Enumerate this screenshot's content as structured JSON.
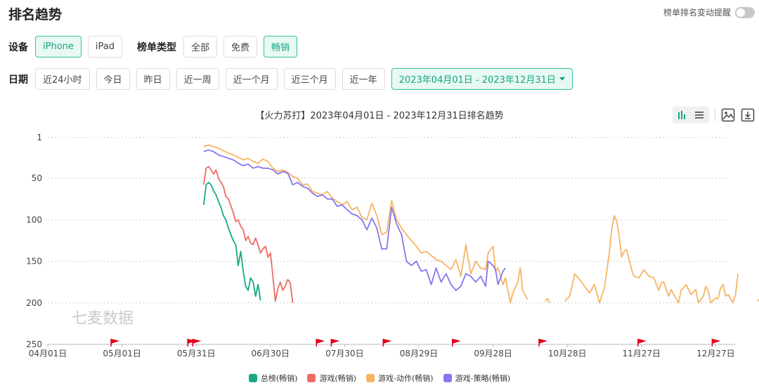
{
  "header": {
    "title": "排名趋势",
    "alert_toggle_label": "榜单排名变动提醒"
  },
  "filters": {
    "device_label": "设备",
    "devices": [
      "iPhone",
      "iPad"
    ],
    "chart_type_label": "榜单类型",
    "chart_types": [
      "全部",
      "免费",
      "畅销"
    ],
    "date_label": "日期",
    "dates": [
      "近24小时",
      "今日",
      "昨日",
      "近一周",
      "近一个月",
      "近三个月",
      "近一年"
    ],
    "date_range": "2023年04月01日 - 2023年12月31日"
  },
  "colors": {
    "accent": "#14a583",
    "total": "#16a984",
    "game": "#ee6b62",
    "action": "#f7b462",
    "strategy": "#8776ee",
    "flag": "#e0001b"
  },
  "watermark": "七麦数据",
  "icons": [
    "bar-chart-icon",
    "list-icon",
    "image-icon",
    "download-icon"
  ],
  "chart_data": {
    "type": "line",
    "title": "【火力苏打】2023年04月01日 - 2023年12月31日排名趋势",
    "y_reversed": true,
    "ylim": [
      1,
      250
    ],
    "yticks": [
      1,
      50,
      100,
      150,
      200,
      250
    ],
    "xlim": [
      "04月01日",
      "12月31日"
    ],
    "xticks": [
      "04月01日",
      "05月01日",
      "05月31日",
      "06月30日",
      "07月30日",
      "08月29日",
      "09月28日",
      "10月28日",
      "11月27日",
      "12月27日"
    ],
    "grid": true,
    "legend_position": "bottom",
    "flags_days": [
      27,
      58,
      60,
      110,
      116,
      137,
      165,
      200,
      240,
      270
    ],
    "series": [
      {
        "name": "总榜(畅销)",
        "color_key": "total",
        "points": [
          [
            63,
            82
          ],
          [
            64,
            58
          ],
          [
            65,
            55
          ],
          [
            66,
            58
          ],
          [
            67,
            65
          ],
          [
            68,
            70
          ],
          [
            69,
            78
          ],
          [
            70,
            85
          ],
          [
            71,
            95
          ],
          [
            72,
            100
          ],
          [
            73,
            110
          ],
          [
            74,
            118
          ],
          [
            75,
            125
          ],
          [
            76,
            130
          ],
          [
            77,
            155
          ],
          [
            78,
            138
          ],
          [
            79,
            162
          ],
          [
            80,
            180
          ],
          [
            81,
            185
          ],
          [
            82,
            170
          ],
          [
            83,
            175
          ],
          [
            84,
            192
          ],
          [
            85,
            178
          ],
          [
            86,
            197
          ]
        ]
      },
      {
        "name": "游戏(畅销)",
        "color_key": "game",
        "points": [
          [
            63,
            58
          ],
          [
            64,
            38
          ],
          [
            65,
            36
          ],
          [
            66,
            40
          ],
          [
            67,
            45
          ],
          [
            68,
            40
          ],
          [
            69,
            50
          ],
          [
            70,
            55
          ],
          [
            71,
            60
          ],
          [
            72,
            72
          ],
          [
            73,
            75
          ],
          [
            74,
            83
          ],
          [
            75,
            92
          ],
          [
            76,
            102
          ],
          [
            77,
            100
          ],
          [
            78,
            108
          ],
          [
            79,
            112
          ],
          [
            80,
            125
          ],
          [
            81,
            120
          ],
          [
            82,
            128
          ],
          [
            83,
            130
          ],
          [
            84,
            122
          ],
          [
            85,
            130
          ],
          [
            86,
            140
          ],
          [
            87,
            135
          ],
          [
            88,
            132
          ],
          [
            89,
            145
          ],
          [
            90,
            140
          ],
          [
            91,
            168
          ],
          [
            92,
            198
          ],
          [
            93,
            183
          ],
          [
            94,
            175
          ],
          [
            95,
            185
          ],
          [
            96,
            180
          ],
          [
            97,
            172
          ],
          [
            98,
            176
          ],
          [
            99,
            200
          ]
        ]
      },
      {
        "name": "游戏-动作(畅销)",
        "color_key": "action",
        "points": [
          [
            63,
            12
          ],
          [
            65,
            10
          ],
          [
            67,
            12
          ],
          [
            69,
            14
          ],
          [
            71,
            17
          ],
          [
            73,
            20
          ],
          [
            75,
            22
          ],
          [
            77,
            25
          ],
          [
            79,
            28
          ],
          [
            81,
            26
          ],
          [
            83,
            30
          ],
          [
            85,
            32
          ],
          [
            87,
            27
          ],
          [
            89,
            30
          ],
          [
            91,
            38
          ],
          [
            93,
            42
          ],
          [
            95,
            40
          ],
          [
            97,
            43
          ],
          [
            99,
            48
          ],
          [
            101,
            50
          ],
          [
            103,
            58
          ],
          [
            105,
            57
          ],
          [
            107,
            66
          ],
          [
            109,
            68
          ],
          [
            111,
            70
          ],
          [
            113,
            66
          ],
          [
            115,
            74
          ],
          [
            117,
            78
          ],
          [
            119,
            82
          ],
          [
            121,
            78
          ],
          [
            123,
            88
          ],
          [
            125,
            85
          ],
          [
            127,
            97
          ],
          [
            129,
            100
          ],
          [
            131,
            80
          ],
          [
            133,
            95
          ],
          [
            135,
            118
          ],
          [
            137,
            115
          ],
          [
            139,
            77
          ],
          [
            141,
            100
          ],
          [
            143,
            110
          ],
          [
            145,
            118
          ],
          [
            147,
            125
          ],
          [
            149,
            132
          ],
          [
            151,
            140
          ],
          [
            153,
            138
          ],
          [
            155,
            143
          ],
          [
            157,
            148
          ],
          [
            159,
            150
          ],
          [
            161,
            155
          ],
          [
            163,
            160
          ],
          [
            165,
            148
          ],
          [
            167,
            168
          ],
          [
            169,
            130
          ],
          [
            171,
            165
          ],
          [
            173,
            150
          ],
          [
            175,
            158
          ],
          [
            177,
            160
          ],
          [
            178,
            140
          ],
          [
            180,
            132
          ],
          [
            181,
            162
          ],
          [
            182,
            158
          ],
          [
            183,
            168
          ],
          [
            184,
            178
          ],
          [
            185,
            170
          ],
          [
            186,
            185
          ],
          [
            187,
            200
          ],
          [
            188,
            188
          ],
          [
            190,
            175
          ],
          [
            191,
            158
          ],
          [
            192,
            185
          ],
          [
            194,
            196
          ],
          [
            201,
            198
          ],
          [
            202,
            195
          ],
          [
            203,
            200
          ],
          [
            209,
            198
          ],
          [
            211,
            192
          ],
          [
            213,
            165
          ],
          [
            215,
            172
          ],
          [
            217,
            180
          ],
          [
            219,
            188
          ],
          [
            221,
            178
          ],
          [
            223,
            200
          ],
          [
            225,
            182
          ],
          [
            227,
            140
          ],
          [
            228,
            110
          ],
          [
            229,
            95
          ],
          [
            230,
            102
          ],
          [
            231,
            120
          ],
          [
            232,
            145
          ],
          [
            233,
            138
          ],
          [
            234,
            136
          ],
          [
            235,
            148
          ],
          [
            236,
            160
          ],
          [
            237,
            168
          ],
          [
            239,
            170
          ],
          [
            241,
            160
          ],
          [
            243,
            168
          ],
          [
            245,
            170
          ],
          [
            247,
            185
          ],
          [
            248,
            176
          ],
          [
            249,
            175
          ],
          [
            251,
            192
          ],
          [
            252,
            184
          ],
          [
            253,
            190
          ],
          [
            255,
            200
          ],
          [
            256,
            185
          ],
          [
            258,
            178
          ],
          [
            260,
            190
          ],
          [
            262,
            184
          ],
          [
            263,
            200
          ],
          [
            265,
            192
          ],
          [
            266,
            180
          ],
          [
            267,
            186
          ],
          [
            268,
            200
          ],
          [
            270,
            194
          ],
          [
            271,
            195
          ],
          [
            272,
            182
          ],
          [
            273,
            178
          ],
          [
            274,
            192
          ],
          [
            275,
            190
          ],
          [
            277,
            200
          ],
          [
            278,
            190
          ],
          [
            279,
            165
          ],
          [
            287,
            198
          ],
          [
            288,
            194
          ],
          [
            290,
            177
          ],
          [
            291,
            195
          ],
          [
            293,
            182
          ],
          [
            294,
            188
          ],
          [
            297,
            183
          ],
          [
            298,
            180
          ],
          [
            299,
            195
          ],
          [
            300,
            185
          ],
          [
            304,
            198
          ],
          [
            305,
            180
          ],
          [
            306,
            185
          ],
          [
            307,
            192
          ]
        ]
      },
      {
        "name": "游戏-策略(畅销)",
        "color_key": "strategy",
        "points": [
          [
            63,
            18
          ],
          [
            65,
            16
          ],
          [
            67,
            18
          ],
          [
            69,
            22
          ],
          [
            71,
            24
          ],
          [
            73,
            26
          ],
          [
            75,
            28
          ],
          [
            77,
            32
          ],
          [
            79,
            35
          ],
          [
            81,
            33
          ],
          [
            83,
            38
          ],
          [
            85,
            36
          ],
          [
            87,
            38
          ],
          [
            89,
            38
          ],
          [
            91,
            40
          ],
          [
            93,
            45
          ],
          [
            95,
            42
          ],
          [
            97,
            44
          ],
          [
            99,
            58
          ],
          [
            101,
            55
          ],
          [
            103,
            60
          ],
          [
            105,
            62
          ],
          [
            107,
            68
          ],
          [
            109,
            72
          ],
          [
            111,
            70
          ],
          [
            113,
            75
          ],
          [
            115,
            75
          ],
          [
            117,
            84
          ],
          [
            119,
            82
          ],
          [
            121,
            88
          ],
          [
            123,
            93
          ],
          [
            125,
            95
          ],
          [
            127,
            100
          ],
          [
            129,
            112
          ],
          [
            131,
            98
          ],
          [
            133,
            110
          ],
          [
            135,
            135
          ],
          [
            137,
            135
          ],
          [
            139,
            85
          ],
          [
            141,
            105
          ],
          [
            143,
            118
          ],
          [
            145,
            150
          ],
          [
            147,
            155
          ],
          [
            149,
            150
          ],
          [
            151,
            162
          ],
          [
            153,
            160
          ],
          [
            155,
            178
          ],
          [
            157,
            158
          ],
          [
            159,
            175
          ],
          [
            161,
            165
          ],
          [
            163,
            178
          ],
          [
            165,
            185
          ],
          [
            167,
            180
          ],
          [
            169,
            165
          ],
          [
            171,
            168
          ],
          [
            173,
            175
          ],
          [
            175,
            168
          ],
          [
            177,
            180
          ],
          [
            178,
            150
          ],
          [
            180,
            155
          ],
          [
            181,
            160
          ],
          [
            182,
            178
          ],
          [
            183,
            170
          ],
          [
            184,
            162
          ],
          [
            185,
            158
          ]
        ]
      }
    ]
  }
}
